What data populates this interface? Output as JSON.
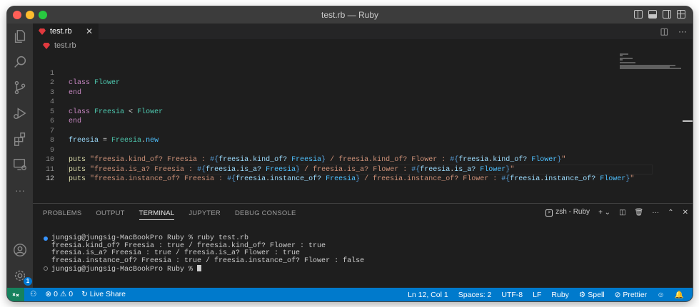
{
  "window": {
    "title": "test.rb — Ruby"
  },
  "tabs": [
    {
      "label": "test.rb",
      "close": "✕"
    }
  ],
  "breadcrumb": {
    "file": "test.rb"
  },
  "editor": {
    "lines": [
      {
        "n": "1"
      },
      {
        "n": "2"
      },
      {
        "n": "3"
      },
      {
        "n": "4"
      },
      {
        "n": "5"
      },
      {
        "n": "6"
      },
      {
        "n": "7"
      },
      {
        "n": "8"
      },
      {
        "n": "9"
      },
      {
        "n": "10"
      },
      {
        "n": "11"
      },
      {
        "n": "12"
      }
    ],
    "tokens": {
      "class": "class",
      "Flower": "Flower",
      "end": "end",
      "Freesia": "Freesia",
      "lt": " < ",
      "freesia": "freesia",
      "eq": " = ",
      "dot_new": ".",
      "new": "new",
      "puts": "puts",
      "l9": {
        "s1": "\"freesia.kind_of? Freesia : ",
        "i1o": "#{",
        "v1": "freesia",
        "d1": ".",
        "m1": "kind_of?",
        "sp1": " ",
        "c1": "Freesia",
        "i1c": "}",
        "s2": " / freesia.kind_of? Flower : ",
        "i2o": "#{",
        "v2": "freesia",
        "d2": ".",
        "m2": "kind_of?",
        "sp2": " ",
        "c2": "Flower",
        "i2c": "}",
        "s3": "\""
      },
      "l10": {
        "s1": "\"freesia.is_a? Freesia : ",
        "i1o": "#{",
        "v1": "freesia",
        "d1": ".",
        "m1": "is_a?",
        "sp1": " ",
        "c1": "Freesia",
        "i1c": "}",
        "s2": " / freesia.is_a? Flower : ",
        "i2o": "#{",
        "v2": "freesia",
        "d2": ".",
        "m2": "is_a?",
        "sp2": " ",
        "c2": "Flower",
        "i2c": "}",
        "s3": "\""
      },
      "l11": {
        "s1": "\"freesia.instance_of? Freesia : ",
        "i1o": "#{",
        "v1": "freesia",
        "d1": ".",
        "m1": "instance_of?",
        "sp1": " ",
        "c1": "Freesia",
        "i1c": "}",
        "s2": " / freesia.instance_of? Flower : ",
        "i2o": "#{",
        "v2": "freesia",
        "d2": ".",
        "m2": "instance_of?",
        "sp2": " ",
        "c2": "Flower",
        "i2c": "}",
        "s3": "\""
      }
    }
  },
  "panel": {
    "tabs": [
      "PROBLEMS",
      "OUTPUT",
      "TERMINAL",
      "JUPYTER",
      "DEBUG CONSOLE"
    ],
    "active_tab": "TERMINAL",
    "shell_label": "zsh - Ruby"
  },
  "terminal": {
    "lines": [
      "jungsig@jungsig-MacBookPro Ruby % ruby test.rb",
      "freesia.kind_of? Freesia : true / freesia.kind_of? Flower : true",
      "freesia.is_a? Freesia : true / freesia.is_a? Flower : true",
      "freesia.instance_of? Freesia : true / freesia.instance_of? Flower : false",
      "jungsig@jungsig-MacBookPro Ruby % "
    ]
  },
  "statusbar": {
    "errors": "0",
    "warnings": "0",
    "live_share": "Live Share",
    "position": "Ln 12, Col 1",
    "spaces": "Spaces: 2",
    "encoding": "UTF-8",
    "eol": "LF",
    "language": "Ruby",
    "spell": "Spell",
    "prettier": "Prettier"
  },
  "activity": {
    "settings_badge": "1"
  },
  "colors": {
    "accent": "#007acc",
    "remote": "#16825d",
    "ruby": "#e0393e"
  }
}
